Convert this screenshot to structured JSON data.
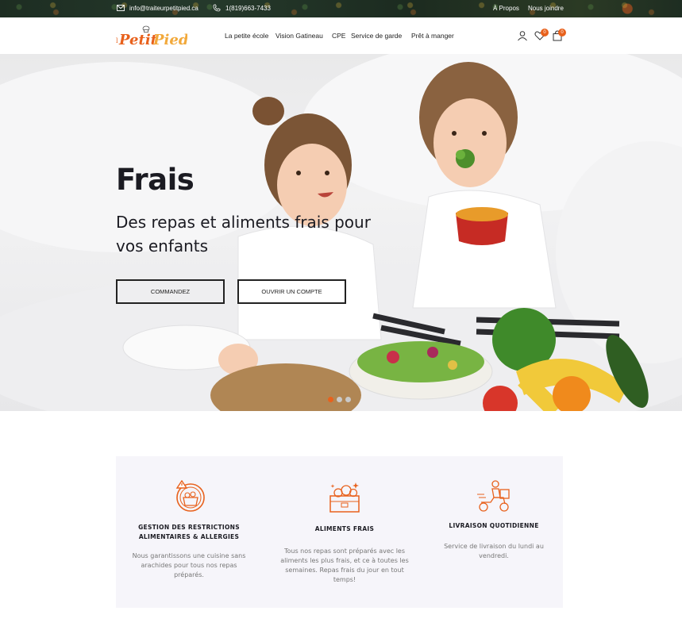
{
  "topbar": {
    "email": "info@traiteurpetitpied.ca",
    "phone": "1(819)663-7433",
    "links": [
      "À Propos",
      "Nous joindre"
    ]
  },
  "header": {
    "logo_text": "Petit Pied",
    "nav": [
      "La petite  école",
      "Vision Gatineau",
      "CPE",
      "Service de garde",
      "Prêt à manger"
    ],
    "wishlist_count": "0",
    "cart_count": "0"
  },
  "hero": {
    "title": "Frais",
    "subtitle": "Des repas et aliments frais pour vos enfants",
    "buttons": [
      "COMMANDEZ",
      "OUVRIR UN COMPTE"
    ],
    "slides": 3,
    "active_slide": 0
  },
  "features": [
    {
      "icon": "allergy-basket-icon",
      "title": "GESTION DES RESTRICTIONS ALIMENTAIRES & ALLERGIES",
      "desc": "Nous garantissons une cuisine sans arachides pour tous nos repas préparés."
    },
    {
      "icon": "fresh-produce-box-icon",
      "title": "ALIMENTS FRAIS",
      "desc": "Tous nos repas sont préparés avec les aliments les plus frais, et ce à toutes les semaines. Repas frais du jour en tout temps!"
    },
    {
      "icon": "delivery-scooter-icon",
      "title": "LIVRAISON QUOTIDIENNE",
      "desc": "Service de livraison du lundi au vendredi."
    }
  ],
  "colors": {
    "accent": "#e8611c",
    "text_dark": "#1b1b22",
    "features_bg": "#f6f5fa"
  }
}
